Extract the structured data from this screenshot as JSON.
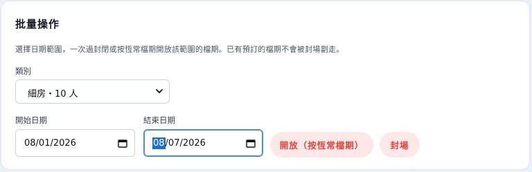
{
  "panel": {
    "title": "批量操作",
    "description": "選擇日期範圍，一次過封閉或按恆常檔期開放該範圍的檔期。已有預訂的檔期不會被封場劏走。"
  },
  "category": {
    "label": "類別",
    "selected": "細房・10 人"
  },
  "start_date": {
    "label": "開始日期",
    "value": "08/01/2026"
  },
  "end_date": {
    "label": "結束日期",
    "value_highlight": "08",
    "value_rest": "/07/2026"
  },
  "actions": {
    "open_label": "開放（按恆常檔期）",
    "close_label": "封場"
  },
  "colors": {
    "accent_red": "#e0453f",
    "button_bg": "#fde8e8",
    "focus_border": "#4a90c8"
  },
  "icons": {
    "select": "chevron-down-icon",
    "date": "calendar-icon"
  }
}
